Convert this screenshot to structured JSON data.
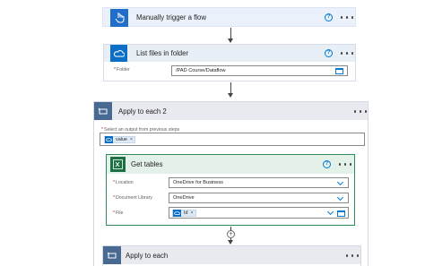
{
  "steps": {
    "trigger": {
      "title": "Manually trigger a flow",
      "help": "?",
      "icon": "touch-icon"
    },
    "list_files": {
      "title": "List files in folder",
      "help": "?",
      "icon": "onedrive-cloud-icon",
      "folder_label": "Folder",
      "folder_value": "/PAD Course/Dataflow"
    },
    "apply_each_2": {
      "title": "Apply to each 2",
      "icon": "loop-icon",
      "select_label": "Select an output from previous steps",
      "token_value": "value",
      "token_remove": "×"
    },
    "get_tables": {
      "title": "Get tables",
      "help": "?",
      "icon": "excel-icon",
      "location_label": "Location",
      "location_value": "OneDrive for Business",
      "library_label": "Document Library",
      "library_value": "OneDrive",
      "file_label": "File",
      "file_token": "Id",
      "file_token_remove": "×"
    },
    "apply_each": {
      "title": "Apply to each",
      "icon": "loop-icon"
    }
  },
  "colors": {
    "trigger_header": "#eaf1fb",
    "trigger_icon": "#1f6fca",
    "onedrive_header": "#e8eef6",
    "onedrive_icon": "#0b6fc6",
    "loop_header": "#e8eaf0",
    "loop_icon": "#486991",
    "excel_border": "#2e8b57",
    "excel_header": "#e4f1e9",
    "excel_icon": "#1d7044"
  }
}
